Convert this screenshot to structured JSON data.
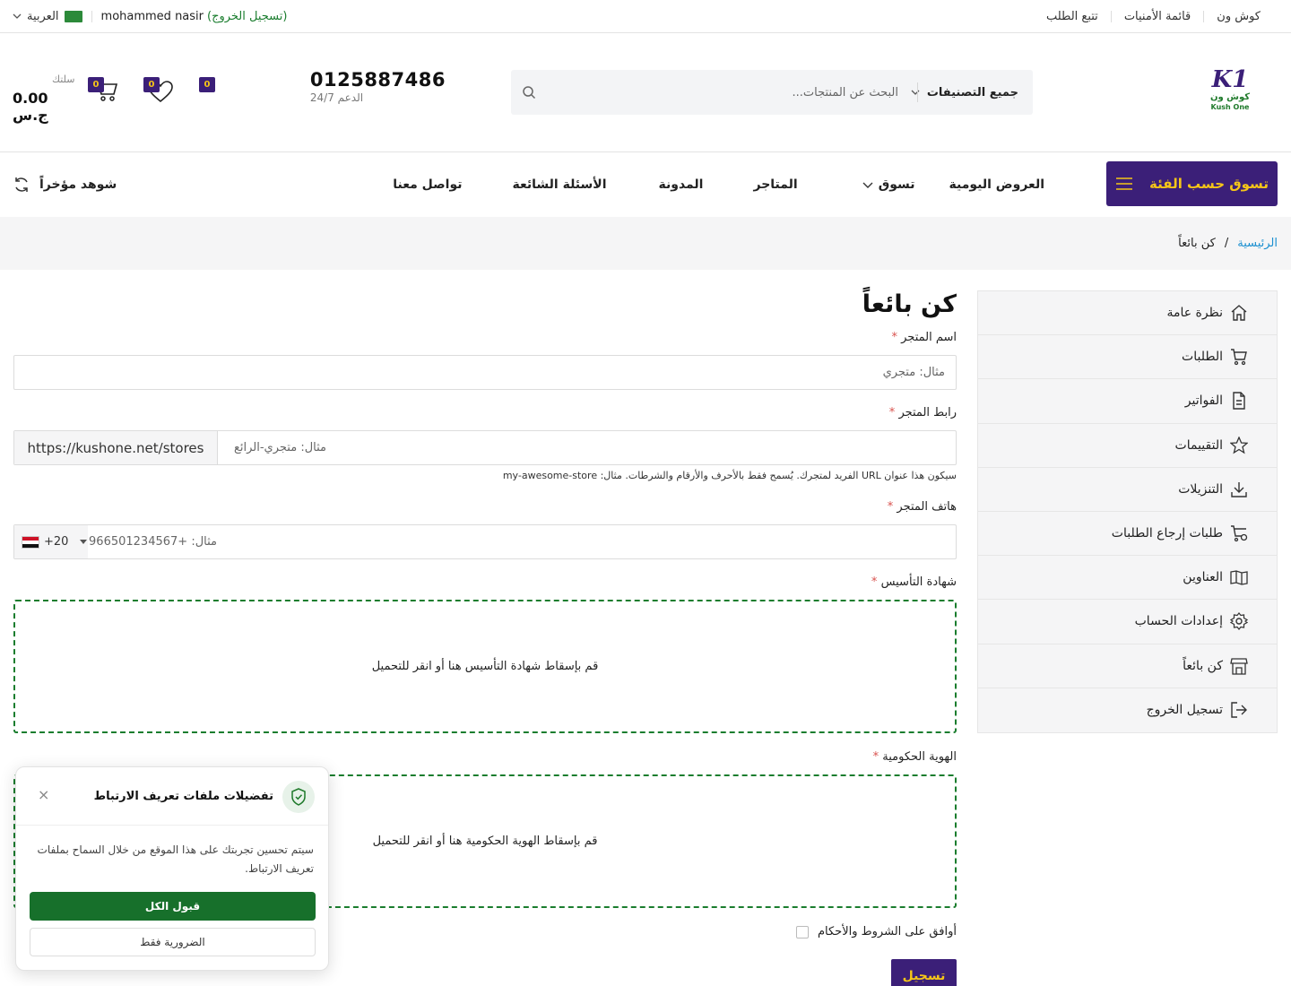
{
  "topbar": {
    "links": [
      "كوش ون",
      "قائمة الأمنيات",
      "تتبع الطلب"
    ],
    "language": "العربية",
    "user_name": "mohammed nasir",
    "logout": "(تسجيل الخروج)"
  },
  "header": {
    "logo": {
      "mark": "K1",
      "arabic": "كوش ون",
      "english": "Kush One"
    },
    "search": {
      "category": "جميع التصنيفات",
      "placeholder": "البحث عن المنتجات..."
    },
    "phone": "0125887486",
    "support": "الدعم 24/7",
    "compare_count": "0",
    "wishlist_count": "0",
    "cart_count": "0",
    "cart_label": "سلتك",
    "cart_total": "0.00 ج.س"
  },
  "nav": {
    "category_button": "تسوق حسب الفئة",
    "items": [
      "العروض اليومية",
      "تسوق",
      "المتاجر",
      "المدونة",
      "الأسئلة الشائعة",
      "تواصل معنا"
    ],
    "recently_viewed": "شوهد مؤخراً"
  },
  "breadcrumb": {
    "home": "الرئيسية",
    "separator": "/",
    "current": "كن بائعاً"
  },
  "sidebar": {
    "items": [
      {
        "label": "نظرة عامة",
        "icon": "home-icon"
      },
      {
        "label": "الطلبات",
        "icon": "cart-icon"
      },
      {
        "label": "الفواتير",
        "icon": "invoice-icon"
      },
      {
        "label": "التقييمات",
        "icon": "star-icon"
      },
      {
        "label": "التنزيلات",
        "icon": "download-icon"
      },
      {
        "label": "طلبات إرجاع الطلبات",
        "icon": "return-cart-icon"
      },
      {
        "label": "العناوين",
        "icon": "book-icon"
      },
      {
        "label": "إعدادات الحساب",
        "icon": "gear-icon"
      },
      {
        "label": "كن بائعاً",
        "icon": "store-icon"
      },
      {
        "label": "تسجيل الخروج",
        "icon": "logout-icon"
      }
    ]
  },
  "form": {
    "title": "كن بائعاً",
    "required_mark": "*",
    "store_name": {
      "label": "اسم المتجر",
      "placeholder": "مثال: متجري"
    },
    "store_url": {
      "label": "رابط المتجر",
      "prefix": "https://kushone.net/stores",
      "placeholder": "مثال: متجري-الرائع",
      "hint": "سيكون هذا عنوان URL الفريد لمتجرك. يُسمح فقط بالأحرف والأرقام والشرطات. مثال: my-awesome-store"
    },
    "store_phone": {
      "label": "هاتف المتجر",
      "code": "+20",
      "placeholder": "مثال: +966501234567"
    },
    "certificate": {
      "label": "شهادة التأسيس",
      "drop_text": "قم بإسقاط شهادة التأسيس هنا أو انقر للتحميل"
    },
    "government_id": {
      "label": "الهوية الحكومية",
      "drop_text": "قم بإسقاط الهوية الحكومية هنا أو انقر للتحميل"
    },
    "terms": "أوافق على الشروط والأحكام",
    "submit": "تسجيل"
  },
  "cookie": {
    "title": "تفضيلات ملفات تعريف الارتباط",
    "body": "سيتم تحسين تجربتك على هذا الموقع من خلال السماح بملفات تعريف الارتباط.",
    "accept_all": "قبول الكل",
    "necessary_only": "الضرورية فقط",
    "close": "×"
  },
  "colors": {
    "brand_purple": "#3b1f78",
    "brand_yellow": "#f5c518",
    "accent_green": "#17702b",
    "link_blue": "#1a8fd0",
    "required_red": "#d9534f"
  }
}
